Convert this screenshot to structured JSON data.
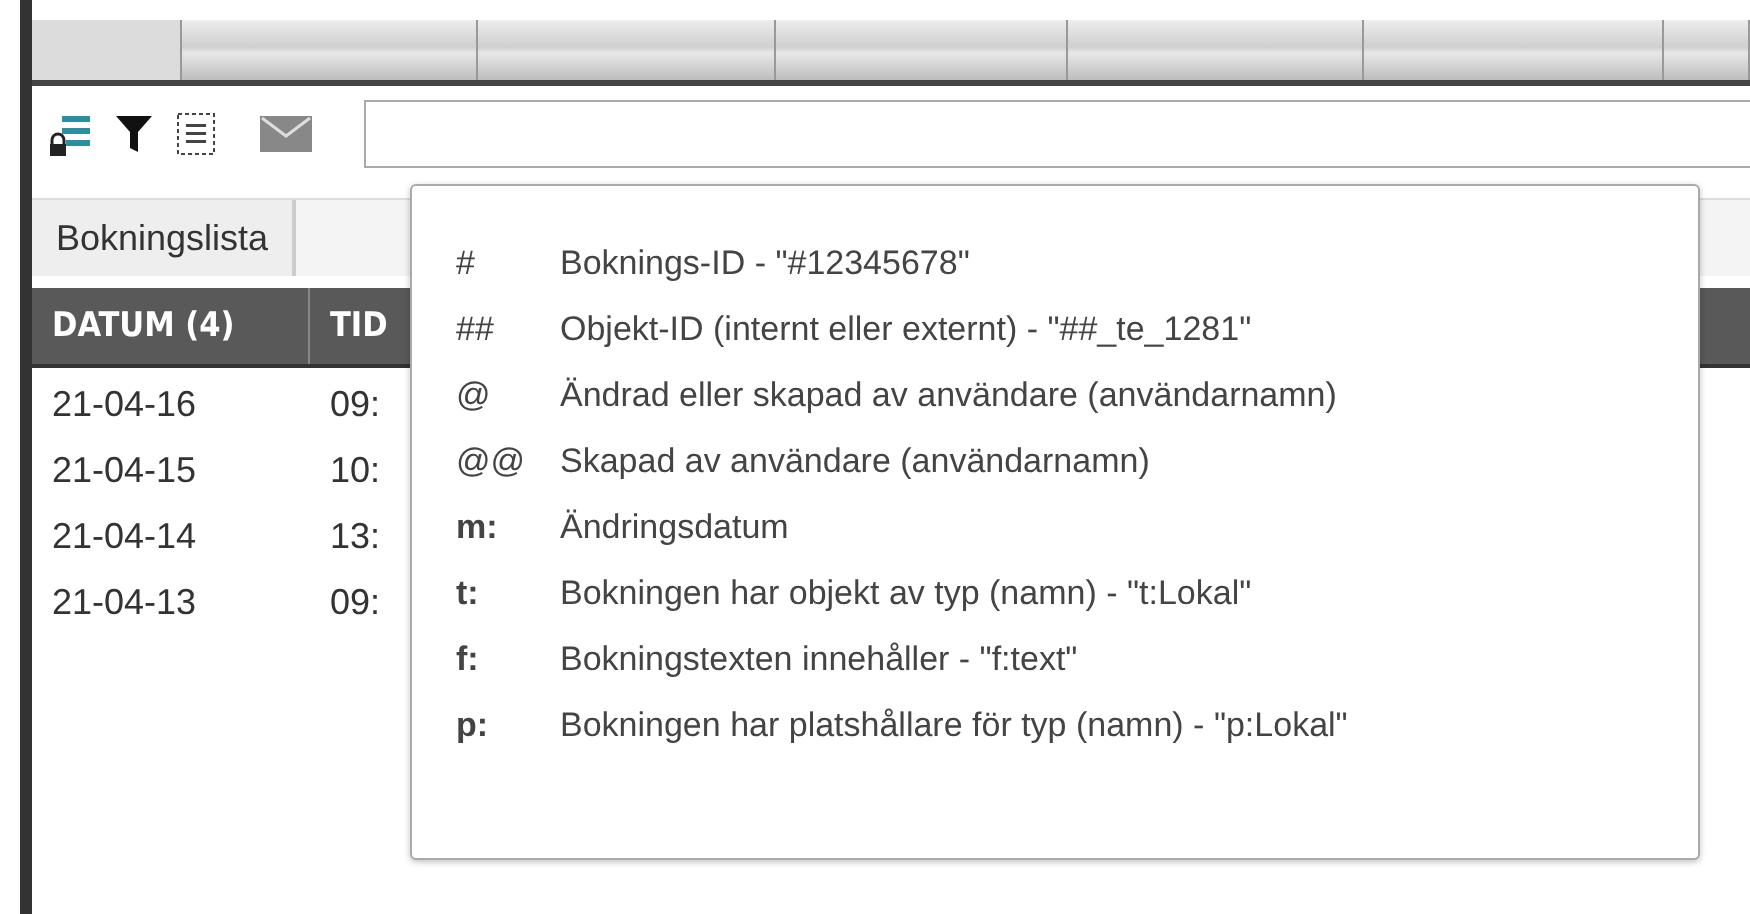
{
  "header_tabs": [
    {
      "selected": true
    },
    {
      "selected": false
    },
    {
      "selected": false
    },
    {
      "selected": false
    },
    {
      "selected": false
    },
    {
      "selected": false
    },
    {
      "selected": false
    }
  ],
  "tabs": [
    {
      "label": "Bokningslista"
    }
  ],
  "table": {
    "columns": [
      "DATUM (4)",
      "TID"
    ],
    "rows": [
      {
        "date": "21-04-16",
        "time": "09:"
      },
      {
        "date": "21-04-15",
        "time": "10:"
      },
      {
        "date": "21-04-14",
        "time": "13:"
      },
      {
        "date": "21-04-13",
        "time": "09:"
      }
    ]
  },
  "search_help": {
    "items": [
      {
        "key": "#",
        "text": "Boknings-ID - \"#12345678\""
      },
      {
        "key": "##",
        "text": "Objekt-ID (internt eller externt) - \"##_te_1281\""
      },
      {
        "key": "@",
        "text": "Ändrad eller skapad av användare (användarnamn)"
      },
      {
        "key": "@@",
        "text": "Skapad av användare (användarnamn)"
      },
      {
        "key": "m:",
        "kind": "prefix",
        "text": "Ändringsdatum"
      },
      {
        "key": "t:",
        "kind": "prefix",
        "text": "Bokningen har objekt av typ (namn) - \"t:Lokal\""
      },
      {
        "key": "f:",
        "kind": "prefix",
        "text": "Bokningstexten innehåller - \"f:text\""
      },
      {
        "key": "p:",
        "kind": "prefix",
        "text": "Bokningen har platshållare för typ (namn) - \"p:Lokal\""
      }
    ]
  }
}
